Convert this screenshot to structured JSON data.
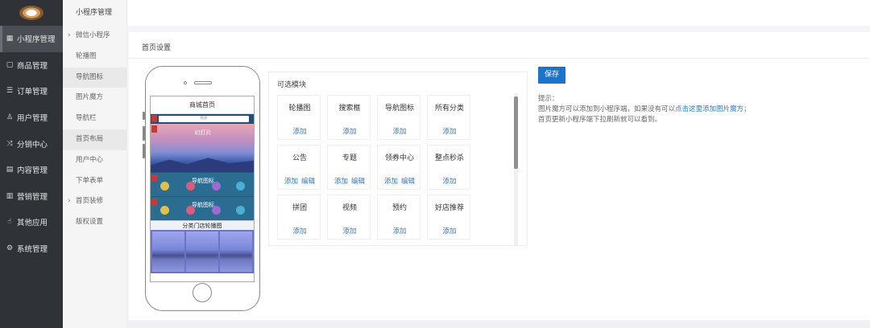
{
  "sidebar": {
    "items": [
      {
        "icon": "grid-icon",
        "label": "小程序管理"
      },
      {
        "icon": "box-icon",
        "label": "商品管理"
      },
      {
        "icon": "list-icon",
        "label": "订单管理"
      },
      {
        "icon": "user-icon",
        "label": "用户管理"
      },
      {
        "icon": "share-icon",
        "label": "分销中心"
      },
      {
        "icon": "content-icon",
        "label": "内容管理"
      },
      {
        "icon": "marketing-icon",
        "label": "营销管理"
      },
      {
        "icon": "apps-icon",
        "label": "其他应用"
      },
      {
        "icon": "gear-icon",
        "label": "系统管理"
      }
    ]
  },
  "submenu": {
    "title": "小程序管理",
    "items": [
      {
        "label": "微信小程序"
      },
      {
        "label": "轮播图"
      },
      {
        "label": "导航图标"
      },
      {
        "label": "图片魔方"
      },
      {
        "label": "导航栏"
      },
      {
        "label": "首页布局"
      },
      {
        "label": "用户中心"
      },
      {
        "label": "下单表单"
      },
      {
        "label": "首页装修"
      },
      {
        "label": "版权设置"
      }
    ]
  },
  "main": {
    "title": "首页设置",
    "phone": {
      "screen_title": "商城首页",
      "search_placeholder": "搜索",
      "banner_label": "幻灯片",
      "nav_label_1": "导航图标",
      "nav_label_2": "导航图标",
      "class_label": "分类门店轮播图"
    },
    "modules": {
      "title": "可选模块",
      "cards": [
        {
          "name": "轮播图",
          "add": "添加",
          "edit": ""
        },
        {
          "name": "搜索框",
          "add": "添加",
          "edit": ""
        },
        {
          "name": "导航图标",
          "add": "添加",
          "edit": ""
        },
        {
          "name": "所有分类",
          "add": "添加",
          "edit": ""
        },
        {
          "name": "公告",
          "add": "添加",
          "edit": "编辑"
        },
        {
          "name": "专题",
          "add": "添加",
          "edit": "编辑"
        },
        {
          "name": "领券中心",
          "add": "添加",
          "edit": "编辑"
        },
        {
          "name": "整点秒杀",
          "add": "添加",
          "edit": ""
        },
        {
          "name": "拼团",
          "add": "添加",
          "edit": ""
        },
        {
          "name": "视频",
          "add": "添加",
          "edit": ""
        },
        {
          "name": "预约",
          "add": "添加",
          "edit": ""
        },
        {
          "name": "好店推荐",
          "add": "添加",
          "edit": ""
        }
      ]
    },
    "save_label": "保存",
    "tips": {
      "heading": "提示：",
      "line1_prefix": "图片魔方可以添加到小程序端，如果没有可以",
      "line1_link": "点击这里添加图片魔方",
      "line1_suffix": "；",
      "line2": "首页更新小程序端下拉刷新就可以看到。"
    }
  },
  "colors": {
    "sidebar_bg": "#2f3237",
    "accent_blue": "#1a74cc",
    "link_blue": "#2b7bd6",
    "tag_red": "#c23b3b"
  }
}
